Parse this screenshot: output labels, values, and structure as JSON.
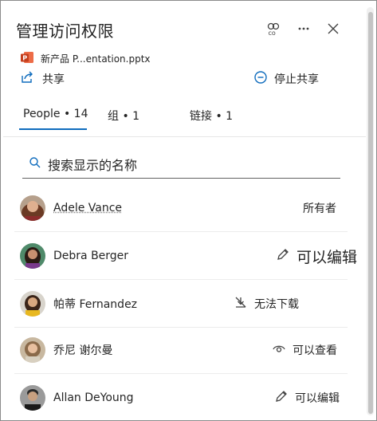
{
  "header": {
    "title": "管理访问权限",
    "icons": [
      "copilot-icon",
      "more-icon",
      "close-icon"
    ]
  },
  "file": {
    "name": "新产品 P...entation.pptx",
    "icon": "powerpoint-icon",
    "icon_color": "#c43e1c"
  },
  "actions": {
    "share_label": "共享",
    "stop_label": "停止共享",
    "accent": "#0f6cbd"
  },
  "tabs": [
    {
      "label": "People • 14",
      "selected": true
    },
    {
      "label": "组 • 1",
      "selected": false
    },
    {
      "label": "链接 • 1",
      "selected": false
    }
  ],
  "search": {
    "placeholder": "搜索显示的名称"
  },
  "people": [
    {
      "name": "Adele Vance",
      "permission": "所有者",
      "perm_icon": ""
    },
    {
      "name": "Debra Berger",
      "permission": "可以编辑",
      "perm_icon": "pencil-icon"
    },
    {
      "name": "帕蒂 Fernandez",
      "permission": "无法下载",
      "perm_icon": "no-download-icon"
    },
    {
      "name": "乔尼 谢尔曼",
      "permission": "可以查看",
      "perm_icon": "eye-icon"
    },
    {
      "name": "Allan DeYoung",
      "permission": "可以编辑",
      "perm_icon": "pencil-icon"
    }
  ]
}
